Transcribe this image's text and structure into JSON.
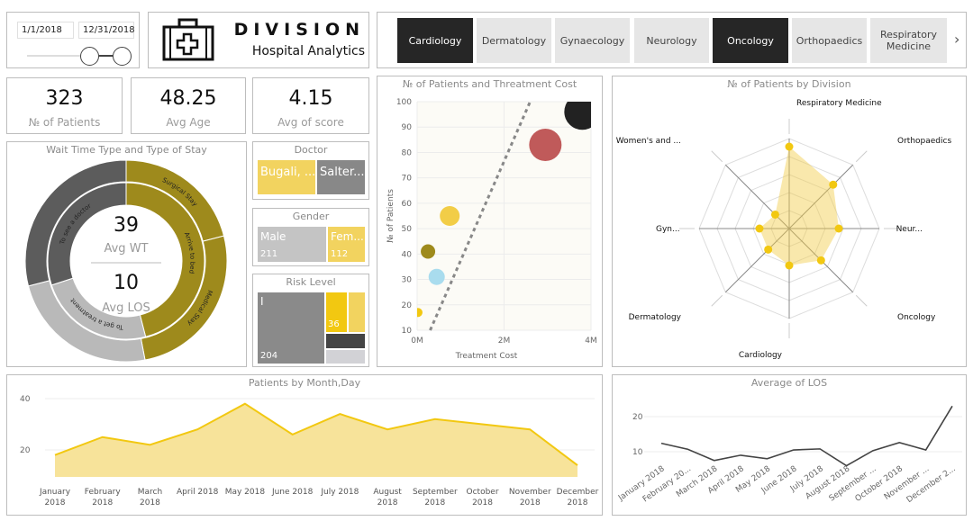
{
  "date_slicer": {
    "start": "1/1/2018",
    "end": "12/31/2018"
  },
  "header": {
    "title": "DIVISION",
    "subtitle": "Hospital Analytics",
    "icon": "medical-kit-icon"
  },
  "divisions": [
    {
      "label": "Cardiology",
      "selected": true
    },
    {
      "label": "Dermatology",
      "selected": false
    },
    {
      "label": "Gynaecology",
      "selected": false
    },
    {
      "label": "Neurology",
      "selected": false
    },
    {
      "label": "Oncology",
      "selected": true
    },
    {
      "label": "Orthopaedics",
      "selected": false
    },
    {
      "label": "Respiratory Medicine",
      "selected": false
    }
  ],
  "kpis": [
    {
      "value": "323",
      "label": "№ of Patients"
    },
    {
      "value": "48.25",
      "label": "Avg Age"
    },
    {
      "value": "4.15",
      "label": "Avg of score"
    }
  ],
  "donut": {
    "title": "Wait Time Type and Type of Stay",
    "center_top_value": "39",
    "center_top_label": "Avg WT",
    "center_bottom_value": "10",
    "center_bottom_label": "Avg LOS",
    "outer": [
      {
        "label": "Surgical Stay",
        "share": 0.21,
        "color": "#9e8a1c"
      },
      {
        "label": "Medical Stay",
        "share": 0.26,
        "color": "#9e8a1c"
      },
      {
        "label": "",
        "share": 0.24,
        "color": "#b9b9b9"
      },
      {
        "label": "",
        "share": 0.29,
        "color": "#5c5c5c"
      }
    ],
    "inner": [
      {
        "label": "Arrive to bed",
        "share": 0.46,
        "color": "#9e8a1c"
      },
      {
        "label": "To get a treatment",
        "share": 0.24,
        "color": "#b9b9b9"
      },
      {
        "label": "To see a doctor",
        "share": 0.3,
        "color": "#5c5c5c"
      }
    ]
  },
  "doctor": {
    "title": "Doctor",
    "items": [
      {
        "label": "Bugali, ...",
        "color": "#f2d35f"
      },
      {
        "label": "Salter...",
        "color": "#888888"
      }
    ]
  },
  "gender": {
    "title": "Gender",
    "items": [
      {
        "label": "Male",
        "count": "211",
        "color": "#c4c4c4"
      },
      {
        "label": "Fem...",
        "count": "112",
        "color": "#f2d35f"
      }
    ]
  },
  "risk": {
    "title": "Risk Level",
    "main_label": "I",
    "main_count": "204",
    "second_count": "36"
  },
  "colors": {
    "accent": "#f2c811",
    "dark": "#262626",
    "olive": "#9e8a1c"
  },
  "chart_data": [
    {
      "type": "scatter",
      "title": "№ of Patients and Threatment Cost",
      "xlabel": "Treatment Cost",
      "ylabel": "№ of Patients",
      "xlim": [
        0,
        4000000
      ],
      "ylim": [
        10,
        100
      ],
      "xticks": [
        "0M",
        "2M",
        "4M"
      ],
      "yticks": [
        "10",
        "20",
        "30",
        "40",
        "50",
        "60",
        "70",
        "80",
        "90",
        "100"
      ],
      "points": [
        {
          "x": 20000,
          "y": 17,
          "size": 5,
          "color": "#f2c811"
        },
        {
          "x": 250000,
          "y": 41,
          "size": 8,
          "color": "#9e8a1c"
        },
        {
          "x": 450000,
          "y": 31,
          "size": 9,
          "color": "#a9dcee"
        },
        {
          "x": 750000,
          "y": 55,
          "size": 11,
          "color": "#f2cd47"
        },
        {
          "x": 2950000,
          "y": 83,
          "size": 18,
          "color": "#c05a5a"
        },
        {
          "x": 3800000,
          "y": 96,
          "size": 20,
          "color": "#222222"
        }
      ],
      "trendline": [
        [
          300000,
          10
        ],
        [
          2600000,
          100
        ]
      ],
      "grid": true
    },
    {
      "type": "radar",
      "title": "№ of Patients by Division",
      "max": 100,
      "categories": [
        "Respiratory Medicine",
        "Orthopaedics",
        "Neur...",
        "Oncology",
        "Cardiology",
        "Dermatology",
        "Gyn...",
        "Women's and ..."
      ],
      "values": [
        91,
        69,
        55,
        50,
        41,
        33,
        33,
        22
      ]
    },
    {
      "type": "area",
      "title": "Patients by Month,Day",
      "categories": [
        "January 2018",
        "February 2018",
        "March 2018",
        "April 2018",
        "May 2018",
        "June 2018",
        "July 2018",
        "August 2018",
        "September 2018",
        "October 2018",
        "November 2018",
        "December 2018"
      ],
      "values": [
        18,
        25,
        22,
        28,
        38,
        26,
        34,
        28,
        32,
        30,
        28,
        14
      ],
      "ylim": [
        9.5,
        44
      ],
      "yticks": [
        "20",
        "40"
      ],
      "grid": true
    },
    {
      "type": "line",
      "title": "Average of LOS",
      "categories": [
        "January 2018",
        "February 20...",
        "March 2018",
        "April 2018",
        "May 2018",
        "June 2018",
        "July 2018",
        "August 2018",
        "September ...",
        "October 2018",
        "November ...",
        "December 2..."
      ],
      "values": [
        12.4,
        10.7,
        7.5,
        9,
        8,
        10.5,
        10.8,
        6,
        10.3,
        12.6,
        10.5,
        23
      ],
      "ylim": [
        3,
        25
      ],
      "yticks": [
        "10",
        "20"
      ],
      "grid": true
    }
  ]
}
